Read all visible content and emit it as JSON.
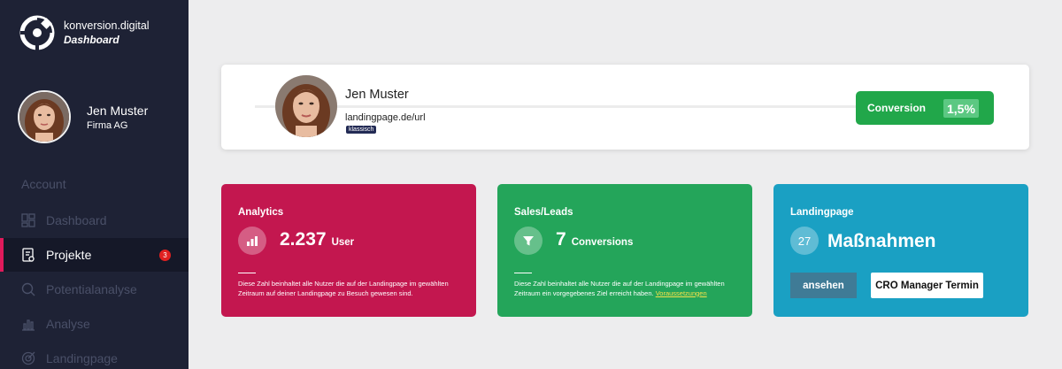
{
  "brand": {
    "name": "konversion.digital",
    "subtitle": "Dashboard",
    "logo_icon": "konversion-logo-icon"
  },
  "user": {
    "name": "Jen Muster",
    "company": "Firma AG"
  },
  "nav": {
    "section": "Account",
    "items": [
      {
        "label": "Dashboard",
        "icon": "dashboard-icon",
        "active": false
      },
      {
        "label": "Projekte",
        "icon": "project-icon",
        "active": true,
        "badge": "3"
      },
      {
        "label": "Potentialanalyse",
        "icon": "search-icon",
        "active": false
      },
      {
        "label": "Analyse",
        "icon": "bar-chart-icon",
        "active": false
      },
      {
        "label": "Landingpage",
        "icon": "target-icon",
        "active": false
      }
    ]
  },
  "profile": {
    "name": "Jen Muster",
    "url": "landingpage.de/url",
    "tag": "klassisch",
    "conversion_label": "Conversion",
    "conversion_value": "1,5%"
  },
  "cards": {
    "analytics": {
      "title": "Analytics",
      "value": "2.237",
      "unit": "User",
      "icon": "bar-chart-icon",
      "description": "Diese Zahl beinhaltet alle Nutzer die auf der Landingpage im gewählten Zeitraum auf deiner Landingpage zu Besuch gewesen sind."
    },
    "sales": {
      "title": "Sales/Leads",
      "value": "7",
      "unit": "Conversions",
      "icon": "funnel-icon",
      "description": "Diese Zahl beinhaltet alle Nutzer die auf der Landingpage im gewählten Zeitraum ein vorgegebenes Ziel erreicht haben.",
      "link": "Voraussetzungen"
    },
    "landing": {
      "title": "Landingpage",
      "count": "27",
      "value": "Maßnahmen",
      "button_view": "ansehen",
      "button_cro": "CRO Manager Termin"
    }
  },
  "colors": {
    "sidebar": "#1e2235",
    "accent": "#e01a5b",
    "analytics": "#c3174f",
    "sales": "#24a55a",
    "landing": "#1aa0c3",
    "conversion": "#21a74a"
  }
}
